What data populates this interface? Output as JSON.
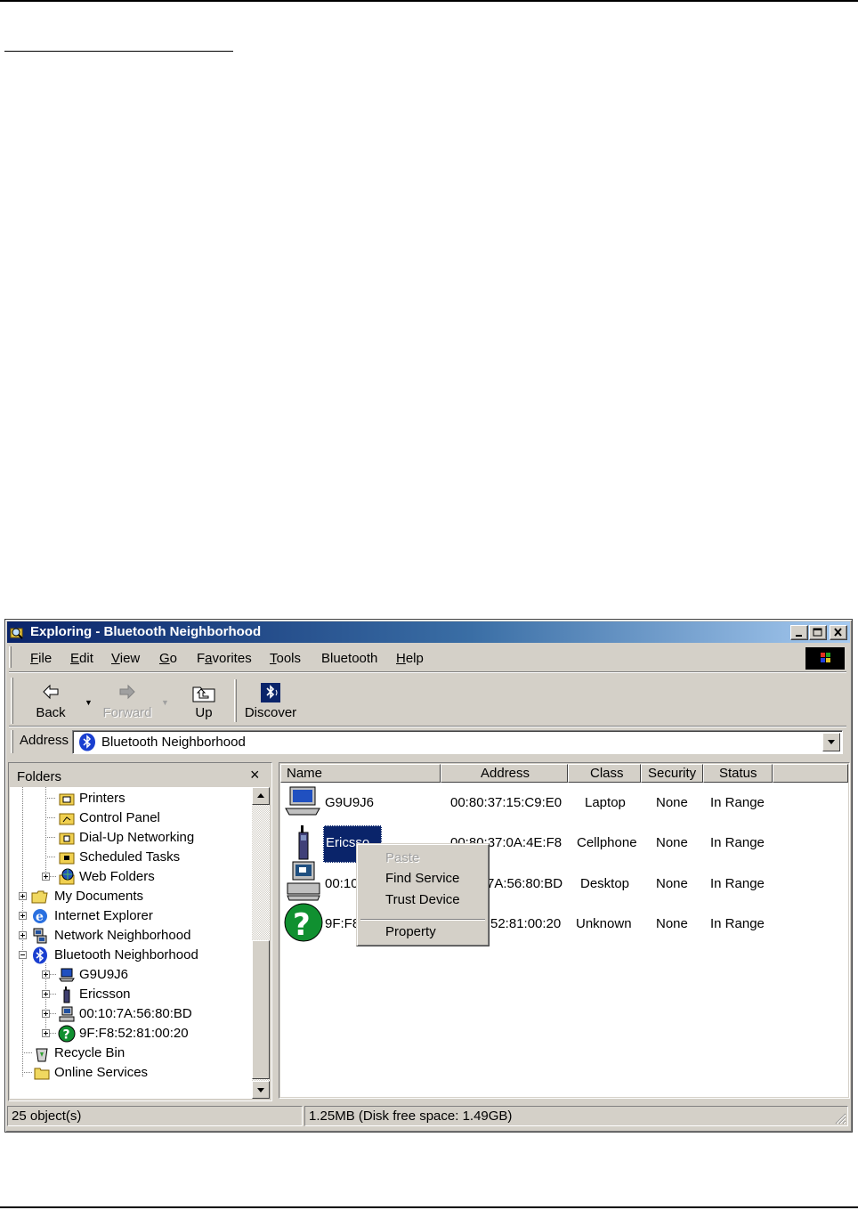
{
  "window": {
    "title": "Exploring - Bluetooth Neighborhood"
  },
  "menu": {
    "file": "File",
    "edit": "Edit",
    "view": "View",
    "go": "Go",
    "favorites": "Favorites",
    "tools": "Tools",
    "bluetooth": "Bluetooth",
    "help": "Help"
  },
  "toolbar": {
    "back": "Back",
    "forward": "Forward",
    "up": "Up",
    "discover": "Discover"
  },
  "address": {
    "label": "Address",
    "value": "Bluetooth Neighborhood"
  },
  "folders": {
    "title": "Folders",
    "close": "×",
    "items": [
      {
        "label": "Printers",
        "icon": "printer-folder-icon"
      },
      {
        "label": "Control Panel",
        "icon": "control-panel-icon"
      },
      {
        "label": "Dial-Up Networking",
        "icon": "dialup-icon"
      },
      {
        "label": "Scheduled Tasks",
        "icon": "scheduled-tasks-icon"
      },
      {
        "label": "Web Folders",
        "icon": "web-folders-icon"
      },
      {
        "label": "My Documents",
        "icon": "folder-open-icon"
      },
      {
        "label": "Internet Explorer",
        "icon": "ie-icon"
      },
      {
        "label": "Network Neighborhood",
        "icon": "network-icon"
      },
      {
        "label": "Bluetooth Neighborhood",
        "icon": "bluetooth-icon"
      },
      {
        "label": "G9U9J6",
        "icon": "laptop-icon"
      },
      {
        "label": "Ericsson",
        "icon": "cellphone-icon"
      },
      {
        "label": "00:10:7A:56:80:BD",
        "icon": "desktop-icon"
      },
      {
        "label": "9F:F8:52:81:00:20",
        "icon": "unknown-device-icon"
      },
      {
        "label": "Recycle Bin",
        "icon": "recycle-bin-icon"
      },
      {
        "label": "Online Services",
        "icon": "folder-icon"
      }
    ]
  },
  "list": {
    "columns": [
      "Name",
      "Address",
      "Class",
      "Security",
      "Status"
    ],
    "rows": [
      {
        "name": "G9U9J6",
        "address": "00:80:37:15:C9:E0",
        "class": "Laptop",
        "security": "None",
        "status": "In Range"
      },
      {
        "name": "Ericsson",
        "name_visible": "Ericsso",
        "address": "00:80:37:0A:4E:F8",
        "address_visible": "00:80:37:0A:4E:F8",
        "class": "Cellphone",
        "security": "None",
        "status": "In Range"
      },
      {
        "name": "00:10",
        "address": "7A:56:80:BD",
        "class": "Desktop",
        "security": "None",
        "status": "In Range"
      },
      {
        "name": "9F:F8",
        "address": "52:81:00:20",
        "class": "Unknown",
        "security": "None",
        "status": "In Range"
      }
    ]
  },
  "context_menu": {
    "paste": "Paste",
    "find_service": "Find Service",
    "trust_device": "Trust Device",
    "property": "Property"
  },
  "status": {
    "objects": "25 object(s)",
    "disk": "1.25MB (Disk free space: 1.49GB)"
  },
  "colors": {
    "face": "#d4d0c8",
    "title_start": "#0a246a",
    "title_end": "#a6caf0",
    "selection": "#0a246a"
  }
}
